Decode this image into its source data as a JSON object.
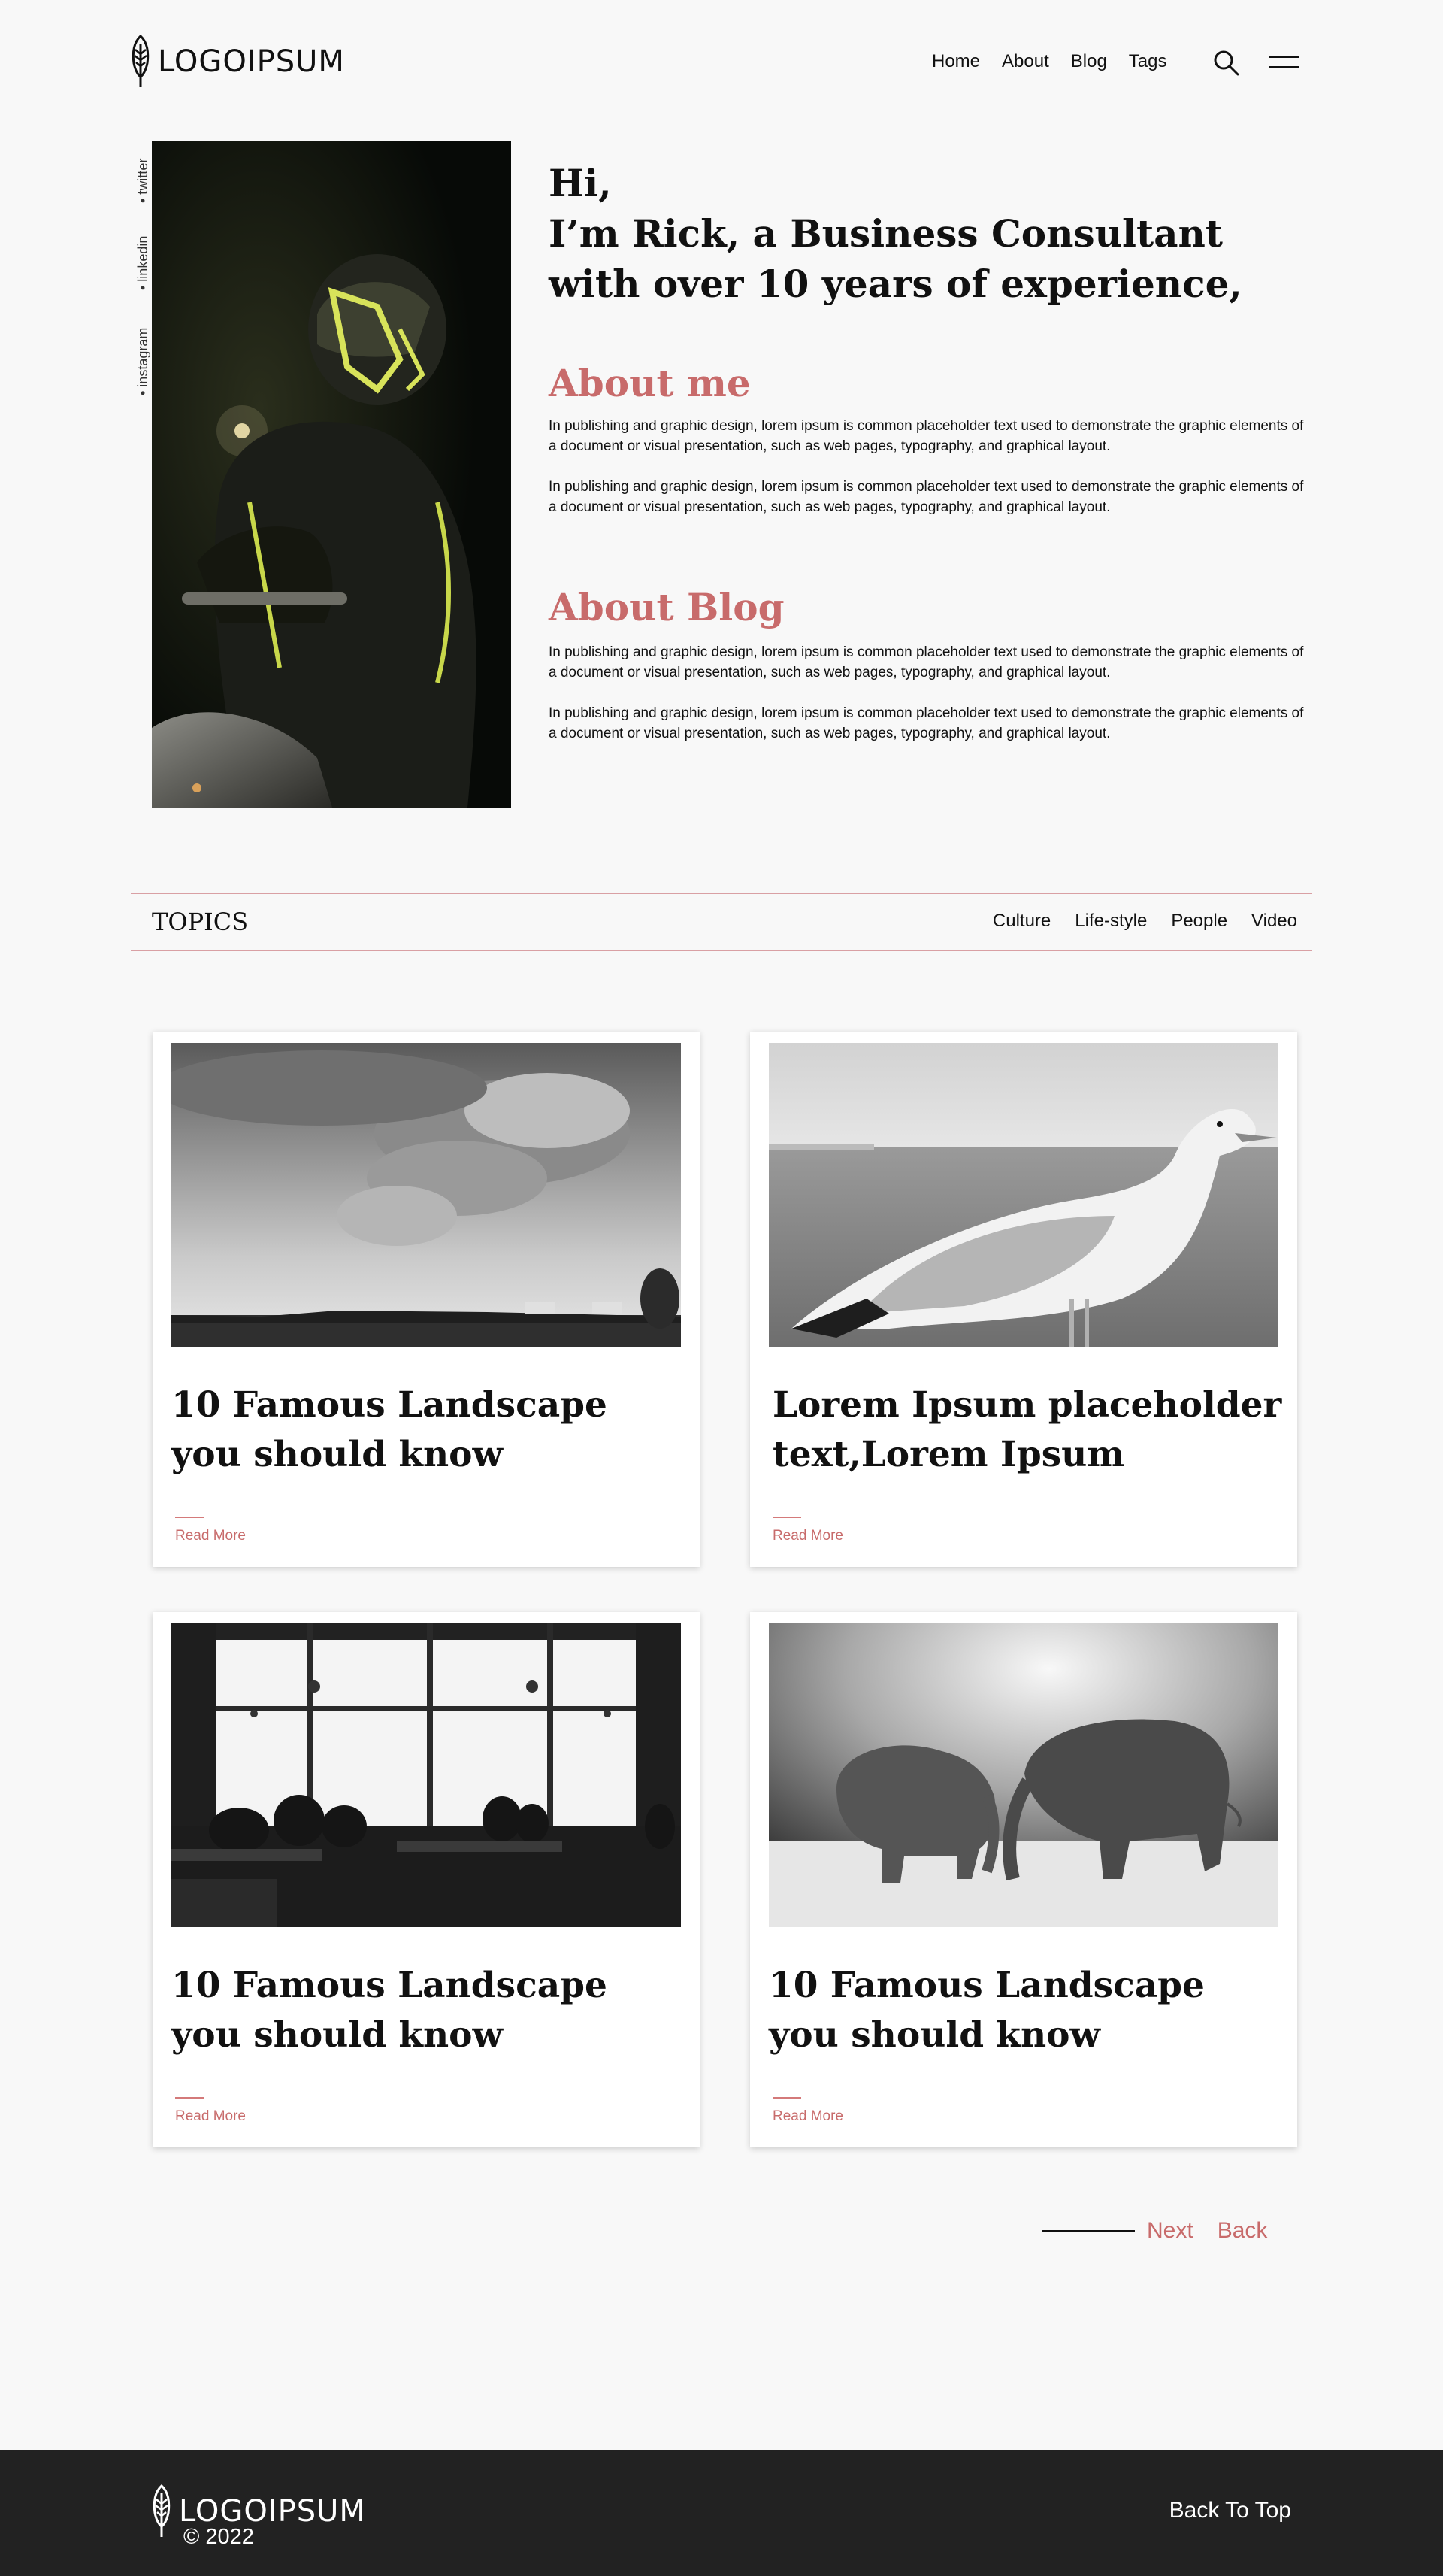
{
  "header": {
    "logo_text": "LOGOIPSUM",
    "nav": [
      "Home",
      "About",
      "Blog",
      "Tags"
    ]
  },
  "hero": {
    "socials": [
      "twitter",
      "linkedin",
      "instagram"
    ],
    "greeting": "Hi,",
    "intro": "I’m Rick, a Business Consultant with over 10 years of experience,",
    "about_me_title": "About me",
    "about_me_paras": [
      "In publishing and graphic design, lorem ipsum is common placeholder text used to demonstrate the graphic elements of a document or visual presentation, such as web pages, typography, and graphical layout.",
      "In publishing and graphic design, lorem ipsum is common placeholder text used to demonstrate the graphic elements of a document or visual presentation, such as web pages, typography, and graphical layout."
    ],
    "about_blog_title": "About Blog",
    "about_blog_paras": [
      "In publishing and graphic design, lorem ipsum is common placeholder text used to demonstrate the graphic elements of a document or visual presentation, such as web pages, typography, and graphical layout.",
      "In publishing and graphic design, lorem ipsum is common placeholder text used to demonstrate the graphic elements of a document or visual presentation, such as web pages, typography, and graphical layout."
    ]
  },
  "topics": {
    "title": "TOPICS",
    "items": [
      "Culture",
      "Life-style",
      "People",
      "Video"
    ]
  },
  "cards": [
    {
      "title": "10 Famous Landscape you should know",
      "read_more": "Read More"
    },
    {
      "title": "Lorem Ipsum placeholder text,Lorem Ipsum",
      "read_more": "Read More"
    },
    {
      "title": "10 Famous Landscape you should know",
      "read_more": "Read More"
    },
    {
      "title": "10 Famous Landscape you should know",
      "read_more": "Read More"
    }
  ],
  "pagination": {
    "next": "Next",
    "back": "Back"
  },
  "footer": {
    "logo_text": "LOGOIPSUM",
    "copyright": "© 2022",
    "back_to_top": "Back To Top"
  },
  "colors": {
    "accent": "#c86b6b",
    "footer_bg": "#222222",
    "page_bg": "#f8f8f8"
  }
}
